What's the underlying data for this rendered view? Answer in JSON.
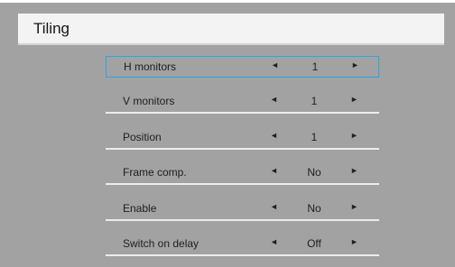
{
  "title": "Tiling",
  "rows": [
    {
      "label": "H monitors",
      "value": "1",
      "selected": true
    },
    {
      "label": "V monitors",
      "value": "1",
      "selected": false
    },
    {
      "label": "Position",
      "value": "1",
      "selected": false
    },
    {
      "label": "Frame comp.",
      "value": "No",
      "selected": false
    },
    {
      "label": "Enable",
      "value": "No",
      "selected": false
    },
    {
      "label": "Switch on delay",
      "value": "Off",
      "selected": false
    }
  ],
  "arrows": {
    "left": "◄",
    "right": "►"
  },
  "colors": {
    "background": "#a2a2a2",
    "title_bar": "#f3f3f3",
    "highlight": "#28a5e4"
  }
}
